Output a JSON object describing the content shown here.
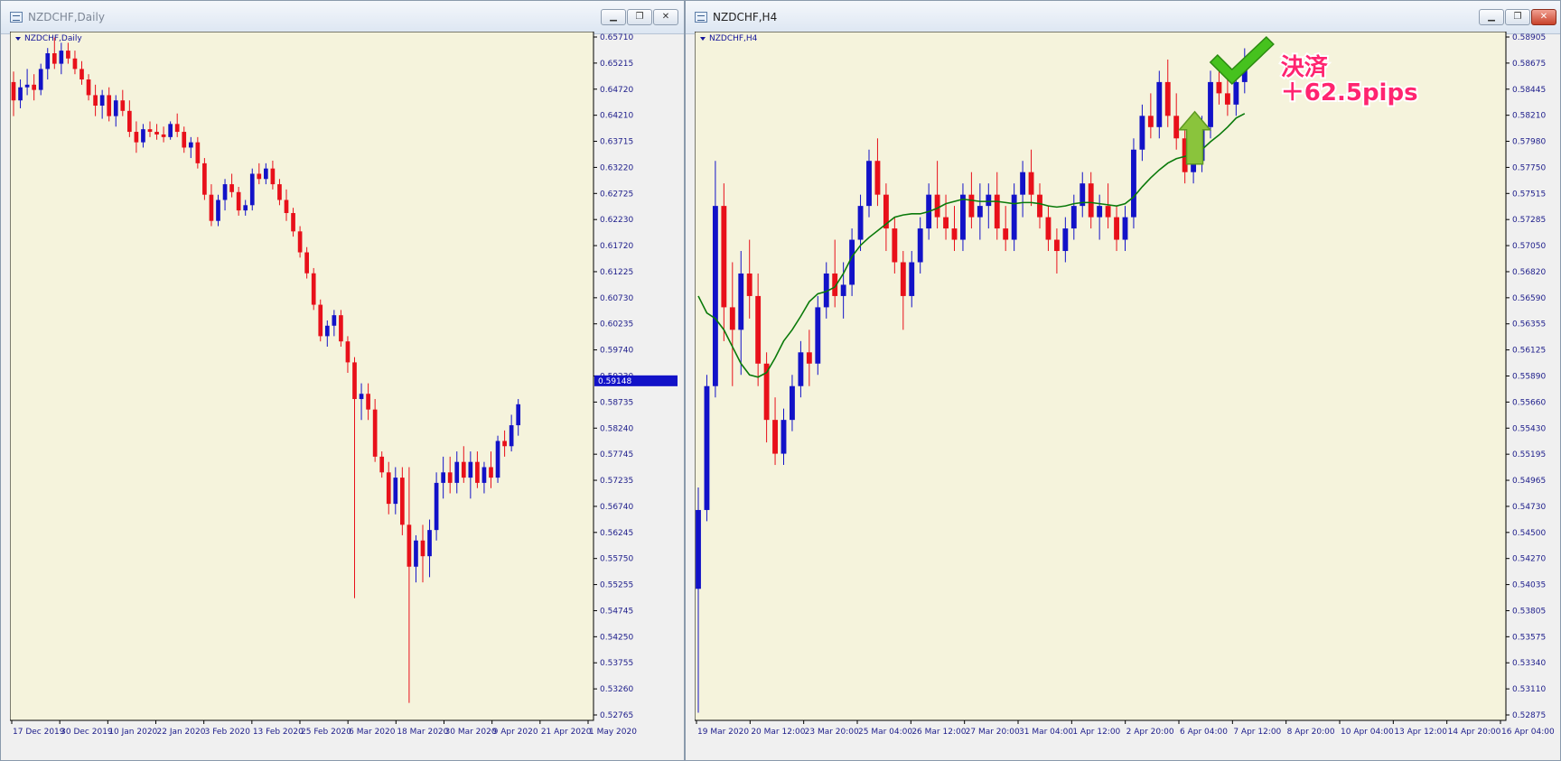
{
  "windows": [
    {
      "title": "NZDCHF,Daily",
      "chart_label": "NZDCHF,Daily",
      "current_price": "0.59148",
      "price_ticks": [
        "0.65710",
        "0.65215",
        "0.64720",
        "0.64210",
        "0.63715",
        "0.63220",
        "0.62725",
        "0.62230",
        "0.61720",
        "0.61225",
        "0.60730",
        "0.60235",
        "0.59740",
        "0.59230",
        "0.58735",
        "0.58240",
        "0.57745",
        "0.57235",
        "0.56740",
        "0.56245",
        "0.55750",
        "0.55255",
        "0.54745",
        "0.54250",
        "0.53755",
        "0.53260",
        "0.52765"
      ],
      "time_ticks": [
        "17 Dec 2019",
        "30 Dec 2019",
        "10 Jan 2020",
        "22 Jan 2020",
        "3 Feb 2020",
        "13 Feb 2020",
        "25 Feb 2020",
        "6 Mar 2020",
        "18 Mar 2020",
        "30 Mar 2020",
        "9 Apr 2020",
        "21 Apr 2020",
        "1 May 2020"
      ]
    },
    {
      "title": "NZDCHF,H4",
      "chart_label": "NZDCHF,H4",
      "price_ticks": [
        "0.58905",
        "0.58675",
        "0.58445",
        "0.58210",
        "0.57980",
        "0.57750",
        "0.57515",
        "0.57285",
        "0.57050",
        "0.56820",
        "0.56590",
        "0.56355",
        "0.56125",
        "0.55890",
        "0.55660",
        "0.55430",
        "0.55195",
        "0.54965",
        "0.54730",
        "0.54500",
        "0.54270",
        "0.54035",
        "0.53805",
        "0.53575",
        "0.53340",
        "0.53110",
        "0.52875"
      ],
      "time_ticks": [
        "19 Mar 2020",
        "20 Mar 12:00",
        "23 Mar 20:00",
        "25 Mar 04:00",
        "26 Mar 12:00",
        "27 Mar 20:00",
        "31 Mar 04:00",
        "1 Apr 12:00",
        "2 Apr 20:00",
        "6 Apr 04:00",
        "7 Apr 12:00",
        "8 Apr 20:00",
        "10 Apr 04:00",
        "13 Apr 12:00",
        "14 Apr 20:00",
        "16 Apr 04:00"
      ]
    }
  ],
  "annotation": {
    "line1": "決済",
    "line2": "＋62.5pips"
  },
  "colors": {
    "bull": "#1212c8",
    "bear": "#e8101a",
    "ma": "#0a7a0a",
    "background": "#f5f3dc",
    "arrow": "#8ac43c",
    "check": "#46c21e",
    "annotation": "#ff2470"
  },
  "icons": [
    "chart-window-icon",
    "minimize-icon",
    "maximize-icon",
    "close-icon",
    "dropdown-triangle-icon",
    "up-arrow-icon",
    "checkmark-icon"
  ],
  "chart_data": [
    {
      "type": "candlestick",
      "symbol": "NZDCHF",
      "timeframe": "Daily",
      "ylim": [
        0.5277,
        0.6571
      ],
      "x_range": [
        "2019-12-17",
        "2020-05-01"
      ],
      "grid": false,
      "candles": [
        [
          0.6485,
          0.6505,
          0.642,
          0.645
        ],
        [
          0.645,
          0.649,
          0.6435,
          0.6475
        ],
        [
          0.6475,
          0.651,
          0.646,
          0.648
        ],
        [
          0.648,
          0.65,
          0.645,
          0.647
        ],
        [
          0.647,
          0.652,
          0.646,
          0.651
        ],
        [
          0.651,
          0.655,
          0.649,
          0.654
        ],
        [
          0.654,
          0.657,
          0.651,
          0.652
        ],
        [
          0.652,
          0.656,
          0.65,
          0.6545
        ],
        [
          0.6545,
          0.656,
          0.652,
          0.653
        ],
        [
          0.653,
          0.6545,
          0.65,
          0.651
        ],
        [
          0.651,
          0.6525,
          0.648,
          0.649
        ],
        [
          0.649,
          0.65,
          0.645,
          0.646
        ],
        [
          0.646,
          0.648,
          0.642,
          0.644
        ],
        [
          0.644,
          0.647,
          0.6415,
          0.646
        ],
        [
          0.646,
          0.6475,
          0.641,
          0.642
        ],
        [
          0.642,
          0.646,
          0.64,
          0.645
        ],
        [
          0.645,
          0.647,
          0.642,
          0.643
        ],
        [
          0.643,
          0.645,
          0.638,
          0.639
        ],
        [
          0.639,
          0.641,
          0.635,
          0.637
        ],
        [
          0.637,
          0.6405,
          0.636,
          0.6395
        ],
        [
          0.6395,
          0.641,
          0.638,
          0.639
        ],
        [
          0.639,
          0.6405,
          0.6375,
          0.6385
        ],
        [
          0.6385,
          0.64,
          0.637,
          0.638
        ],
        [
          0.638,
          0.641,
          0.6375,
          0.6405
        ],
        [
          0.6405,
          0.6425,
          0.638,
          0.639
        ],
        [
          0.639,
          0.64,
          0.635,
          0.636
        ],
        [
          0.636,
          0.638,
          0.634,
          0.637
        ],
        [
          0.637,
          0.638,
          0.632,
          0.633
        ],
        [
          0.633,
          0.634,
          0.626,
          0.627
        ],
        [
          0.627,
          0.629,
          0.621,
          0.622
        ],
        [
          0.622,
          0.627,
          0.621,
          0.626
        ],
        [
          0.626,
          0.63,
          0.624,
          0.629
        ],
        [
          0.629,
          0.631,
          0.6265,
          0.6275
        ],
        [
          0.6275,
          0.6285,
          0.623,
          0.624
        ],
        [
          0.624,
          0.626,
          0.623,
          0.625
        ],
        [
          0.625,
          0.632,
          0.624,
          0.631
        ],
        [
          0.631,
          0.633,
          0.629,
          0.63
        ],
        [
          0.63,
          0.633,
          0.629,
          0.632
        ],
        [
          0.632,
          0.6335,
          0.628,
          0.629
        ],
        [
          0.629,
          0.63,
          0.625,
          0.626
        ],
        [
          0.626,
          0.628,
          0.622,
          0.6235
        ],
        [
          0.6235,
          0.6245,
          0.619,
          0.62
        ],
        [
          0.62,
          0.621,
          0.615,
          0.616
        ],
        [
          0.616,
          0.617,
          0.611,
          0.612
        ],
        [
          0.612,
          0.613,
          0.605,
          0.606
        ],
        [
          0.606,
          0.607,
          0.599,
          0.6
        ],
        [
          0.6,
          0.603,
          0.598,
          0.602
        ],
        [
          0.602,
          0.605,
          0.6,
          0.604
        ],
        [
          0.604,
          0.605,
          0.598,
          0.599
        ],
        [
          0.599,
          0.6,
          0.593,
          0.595
        ],
        [
          0.595,
          0.596,
          0.55,
          0.588
        ],
        [
          0.588,
          0.591,
          0.584,
          0.589
        ],
        [
          0.589,
          0.591,
          0.584,
          0.586
        ],
        [
          0.586,
          0.588,
          0.576,
          0.577
        ],
        [
          0.577,
          0.578,
          0.573,
          0.574
        ],
        [
          0.574,
          0.576,
          0.566,
          0.568
        ],
        [
          0.568,
          0.575,
          0.566,
          0.573
        ],
        [
          0.573,
          0.575,
          0.562,
          0.564
        ],
        [
          0.564,
          0.575,
          0.53,
          0.556
        ],
        [
          0.556,
          0.562,
          0.553,
          0.561
        ],
        [
          0.561,
          0.564,
          0.553,
          0.558
        ],
        [
          0.558,
          0.565,
          0.554,
          0.563
        ],
        [
          0.563,
          0.574,
          0.561,
          0.572
        ],
        [
          0.572,
          0.577,
          0.569,
          0.574
        ],
        [
          0.574,
          0.577,
          0.57,
          0.572
        ],
        [
          0.572,
          0.578,
          0.57,
          0.576
        ],
        [
          0.576,
          0.579,
          0.572,
          0.573
        ],
        [
          0.573,
          0.578,
          0.569,
          0.576
        ],
        [
          0.576,
          0.578,
          0.571,
          0.572
        ],
        [
          0.572,
          0.576,
          0.57,
          0.575
        ],
        [
          0.575,
          0.578,
          0.571,
          0.573
        ],
        [
          0.573,
          0.581,
          0.572,
          0.58
        ],
        [
          0.58,
          0.582,
          0.577,
          0.579
        ],
        [
          0.579,
          0.585,
          0.578,
          0.583
        ],
        [
          0.583,
          0.588,
          0.581,
          0.587
        ]
      ]
    },
    {
      "type": "candlestick",
      "symbol": "NZDCHF",
      "timeframe": "H4",
      "ylim": [
        0.5288,
        0.589
      ],
      "x_range": [
        "2020-03-19 00:00",
        "2020-04-16 04:00"
      ],
      "grid": false,
      "indicator": "moving average",
      "candles": [
        [
          0.54,
          0.549,
          0.529,
          0.547
        ],
        [
          0.547,
          0.559,
          0.546,
          0.558
        ],
        [
          0.558,
          0.578,
          0.557,
          0.574
        ],
        [
          0.574,
          0.576,
          0.562,
          0.565
        ],
        [
          0.565,
          0.569,
          0.558,
          0.563
        ],
        [
          0.563,
          0.57,
          0.559,
          0.568
        ],
        [
          0.568,
          0.571,
          0.564,
          0.566
        ],
        [
          0.566,
          0.568,
          0.558,
          0.56
        ],
        [
          0.56,
          0.561,
          0.553,
          0.555
        ],
        [
          0.555,
          0.557,
          0.551,
          0.552
        ],
        [
          0.552,
          0.556,
          0.551,
          0.555
        ],
        [
          0.555,
          0.559,
          0.554,
          0.558
        ],
        [
          0.558,
          0.562,
          0.557,
          0.561
        ],
        [
          0.561,
          0.563,
          0.558,
          0.56
        ],
        [
          0.56,
          0.566,
          0.559,
          0.565
        ],
        [
          0.565,
          0.569,
          0.564,
          0.568
        ],
        [
          0.568,
          0.571,
          0.565,
          0.566
        ],
        [
          0.566,
          0.569,
          0.564,
          0.567
        ],
        [
          0.567,
          0.572,
          0.566,
          0.571
        ],
        [
          0.571,
          0.575,
          0.57,
          0.574
        ],
        [
          0.574,
          0.579,
          0.573,
          0.578
        ],
        [
          0.578,
          0.58,
          0.574,
          0.575
        ],
        [
          0.575,
          0.576,
          0.57,
          0.572
        ],
        [
          0.572,
          0.573,
          0.568,
          0.569
        ],
        [
          0.569,
          0.57,
          0.563,
          0.566
        ],
        [
          0.566,
          0.57,
          0.565,
          0.569
        ],
        [
          0.569,
          0.573,
          0.568,
          0.572
        ],
        [
          0.572,
          0.576,
          0.571,
          0.575
        ],
        [
          0.575,
          0.578,
          0.572,
          0.573
        ],
        [
          0.573,
          0.575,
          0.571,
          0.572
        ],
        [
          0.572,
          0.574,
          0.57,
          0.571
        ],
        [
          0.571,
          0.576,
          0.57,
          0.575
        ],
        [
          0.575,
          0.577,
          0.572,
          0.573
        ],
        [
          0.573,
          0.576,
          0.571,
          0.574
        ],
        [
          0.574,
          0.576,
          0.572,
          0.575
        ],
        [
          0.575,
          0.577,
          0.571,
          0.572
        ],
        [
          0.572,
          0.574,
          0.57,
          0.571
        ],
        [
          0.571,
          0.576,
          0.57,
          0.575
        ],
        [
          0.575,
          0.578,
          0.573,
          0.577
        ],
        [
          0.577,
          0.579,
          0.574,
          0.575
        ],
        [
          0.575,
          0.576,
          0.572,
          0.573
        ],
        [
          0.573,
          0.574,
          0.57,
          0.571
        ],
        [
          0.571,
          0.572,
          0.568,
          0.57
        ],
        [
          0.57,
          0.573,
          0.569,
          0.572
        ],
        [
          0.572,
          0.575,
          0.571,
          0.574
        ],
        [
          0.574,
          0.577,
          0.573,
          0.576
        ],
        [
          0.576,
          0.577,
          0.572,
          0.573
        ],
        [
          0.573,
          0.575,
          0.571,
          0.574
        ],
        [
          0.574,
          0.576,
          0.572,
          0.573
        ],
        [
          0.573,
          0.574,
          0.57,
          0.571
        ],
        [
          0.571,
          0.574,
          0.57,
          0.573
        ],
        [
          0.573,
          0.58,
          0.572,
          0.579
        ],
        [
          0.579,
          0.583,
          0.578,
          0.582
        ],
        [
          0.582,
          0.584,
          0.58,
          0.581
        ],
        [
          0.581,
          0.586,
          0.58,
          0.585
        ],
        [
          0.585,
          0.587,
          0.581,
          0.582
        ],
        [
          0.582,
          0.584,
          0.579,
          0.58
        ],
        [
          0.58,
          0.581,
          0.576,
          0.577
        ],
        [
          0.577,
          0.579,
          0.576,
          0.578
        ],
        [
          0.578,
          0.582,
          0.577,
          0.581
        ],
        [
          0.581,
          0.586,
          0.58,
          0.585
        ],
        [
          0.585,
          0.587,
          0.583,
          0.584
        ],
        [
          0.584,
          0.586,
          0.582,
          0.583
        ],
        [
          0.583,
          0.586,
          0.582,
          0.585
        ],
        [
          0.585,
          0.588,
          0.584,
          0.587
        ]
      ],
      "ma": [
        0.566,
        0.5645,
        0.564,
        0.563,
        0.5615,
        0.56,
        0.559,
        0.5588,
        0.5592,
        0.5605,
        0.562,
        0.563,
        0.5642,
        0.5655,
        0.5662,
        0.5664,
        0.5668,
        0.568,
        0.5695,
        0.5705,
        0.5712,
        0.5718,
        0.5724,
        0.573,
        0.5732,
        0.5733,
        0.5733,
        0.5735,
        0.5738,
        0.5742,
        0.5744,
        0.5746,
        0.5745,
        0.5744,
        0.5744,
        0.5744,
        0.5743,
        0.5742,
        0.5743,
        0.5743,
        0.5742,
        0.574,
        0.5739,
        0.574,
        0.5742,
        0.5743,
        0.5743,
        0.5742,
        0.5741,
        0.574,
        0.5742,
        0.5748,
        0.5757,
        0.5765,
        0.5772,
        0.5778,
        0.5782,
        0.5784,
        0.5786,
        0.579,
        0.5797,
        0.5803,
        0.581,
        0.5818,
        0.5822
      ]
    }
  ]
}
